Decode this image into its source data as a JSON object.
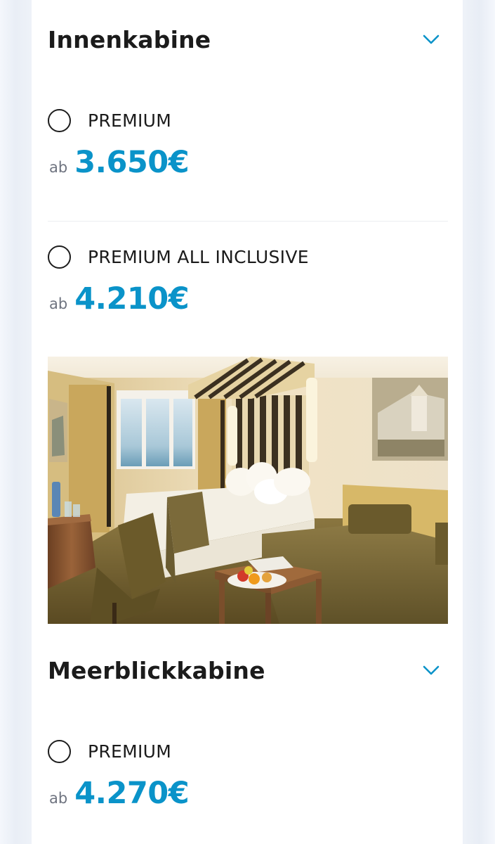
{
  "sections": [
    {
      "title": "Innenkabine",
      "chevron_icon": "chevron-down-icon",
      "options": [
        {
          "label": "PREMIUM",
          "price_prefix": "ab",
          "price": "3.650€"
        },
        {
          "label": "PREMIUM ALL INCLUSIVE",
          "price_prefix": "ab",
          "price": "4.210€"
        }
      ]
    },
    {
      "title": "Meerblickkabine",
      "chevron_icon": "chevron-down-icon",
      "options": [
        {
          "label": "PREMIUM",
          "price_prefix": "ab",
          "price": "4.270€"
        }
      ]
    }
  ],
  "image": {
    "alt": "cabin-interior-photo"
  },
  "colors": {
    "accent": "#0a93c9",
    "text": "#1b1b1b",
    "muted": "#6f7480",
    "background": "#eef2f8"
  }
}
